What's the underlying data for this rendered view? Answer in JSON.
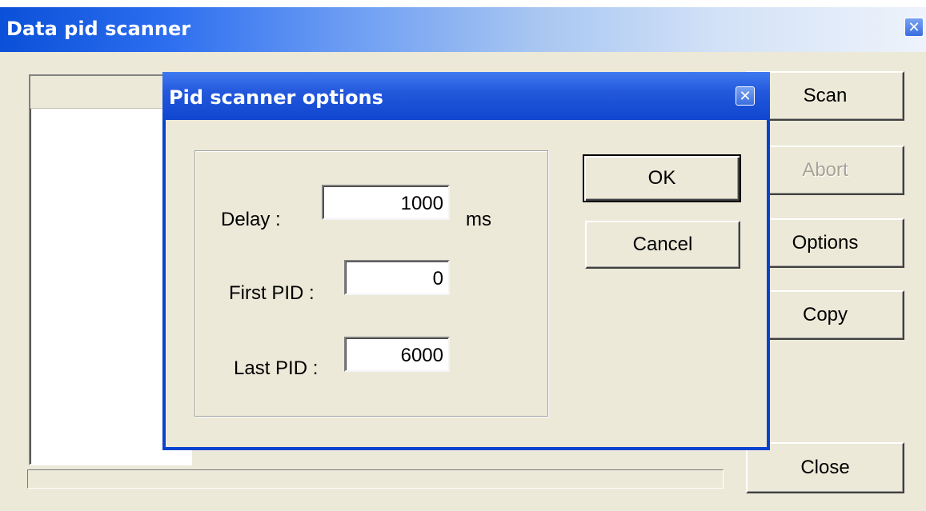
{
  "outer_window": {
    "title": "Data pid scanner",
    "close_glyph": "✕",
    "buttons": {
      "scan": "Scan",
      "abort": "Abort",
      "options": "Options",
      "copy": "Copy",
      "close": "Close"
    }
  },
  "dialog": {
    "title": "Pid scanner options",
    "close_glyph": "✕",
    "delay": {
      "label": "Delay :",
      "value": "1000",
      "unit": "ms"
    },
    "first_pid": {
      "label": "First PID :",
      "value": "0"
    },
    "last_pid": {
      "label": "Last PID :",
      "value": "6000"
    },
    "ok_label": "OK",
    "cancel_label": "Cancel"
  },
  "icons": {
    "outer_close": "close-icon",
    "dialog_close": "close-icon"
  },
  "colors": {
    "titlebar_blue": "#0a50d8",
    "dialog_frame": "#0842d0",
    "window_face": "#ece9d8",
    "disabled_text": "#a8a496"
  },
  "abort_enabled": false
}
